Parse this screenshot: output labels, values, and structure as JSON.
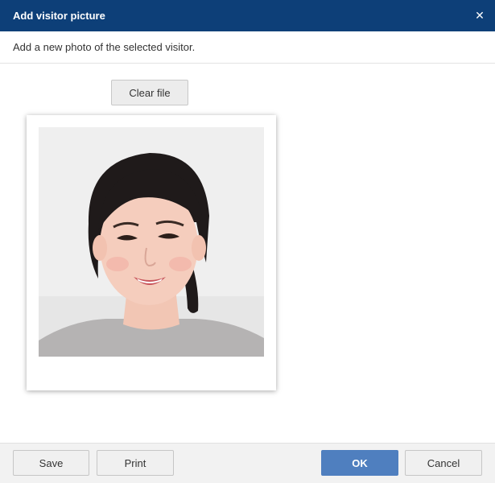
{
  "dialog": {
    "title": "Add visitor picture",
    "close_glyph": "✕",
    "description": "Add a new photo of the selected visitor."
  },
  "content": {
    "clear_file_label": "Clear file",
    "photo_alt": "visitor-photo"
  },
  "footer": {
    "save_label": "Save",
    "print_label": "Print",
    "ok_label": "OK",
    "cancel_label": "Cancel"
  },
  "colors": {
    "titlebar": "#0d3f78",
    "primary_button": "#4f7fbf"
  }
}
